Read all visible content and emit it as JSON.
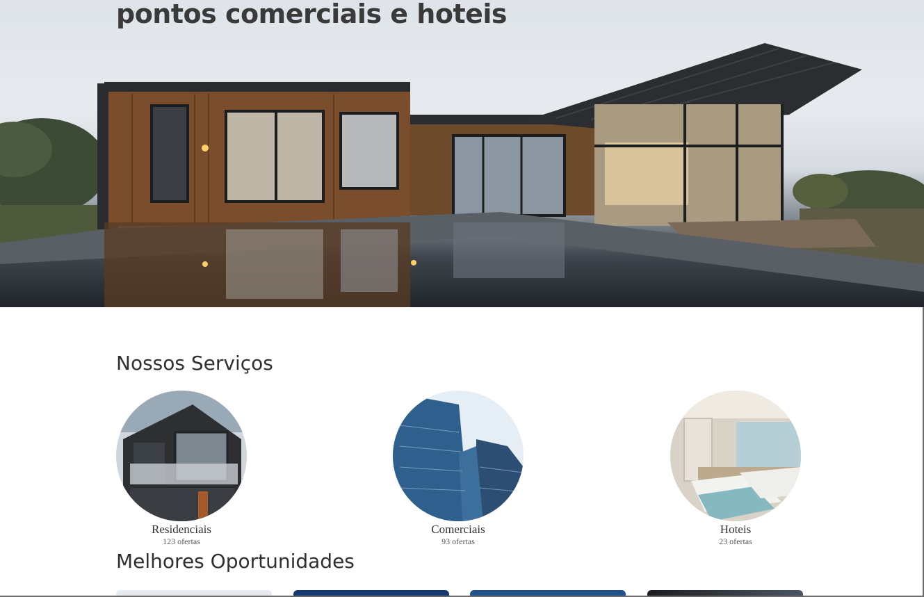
{
  "hero": {
    "title": "pontos comerciais e hoteis"
  },
  "services": {
    "title": "Nossos Serviços",
    "items": [
      {
        "name": "Residenciais",
        "count": "123 ofertas",
        "icon": "house-photo"
      },
      {
        "name": "Comerciais",
        "count": "93 ofertas",
        "icon": "office-tower-photo"
      },
      {
        "name": "Hoteis",
        "count": "23 ofertas",
        "icon": "hotel-room-photo"
      }
    ]
  },
  "opportunities": {
    "title": "Melhores Oportunidades"
  },
  "colors": {
    "text": "#2f2f2f",
    "hero_sky": "#e3e7ec",
    "water": "#1f232a"
  }
}
